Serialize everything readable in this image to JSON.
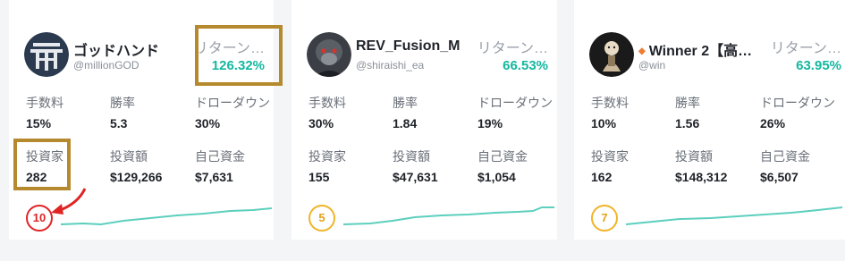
{
  "labels": {
    "fee": "手数料",
    "win_rate": "勝率",
    "drawdown": "ドローダウン",
    "investors": "投資家",
    "investment": "投資額",
    "own_funds": "自己資金"
  },
  "cards": [
    {
      "name": "ゴッドハンド",
      "handle": "@millionGOD",
      "return_label": "リターン…",
      "return_value": "126.32%",
      "fee": "15%",
      "win_rate": "5.3",
      "drawdown": "30%",
      "investors": "282",
      "investment": "$129,266",
      "own_funds": "$7,631",
      "rank": "10"
    },
    {
      "name": "REV_Fusion_M",
      "handle": "@shiraishi_ea",
      "return_label": "リターン…",
      "return_value": "66.53%",
      "fee": "30%",
      "win_rate": "1.84",
      "drawdown": "19%",
      "investors": "155",
      "investment": "$47,631",
      "own_funds": "$1,054",
      "rank": "5"
    },
    {
      "name": "Winner 2【高…",
      "handle": "@win",
      "return_label": "リターン…",
      "return_value": "63.95%",
      "fee": "10%",
      "win_rate": "1.56",
      "drawdown": "26%",
      "investors": "162",
      "investment": "$148,312",
      "own_funds": "$6,507",
      "rank": "7"
    }
  ],
  "colors": {
    "return": "#14b8a0",
    "sparkline": "#5ccfbd",
    "rank_highlight": "#e02424",
    "rank_default": "#f0b429",
    "annotation_box": "#b58a2f",
    "annotation_arrow": "#e02424"
  },
  "icons": [
    "crest-logo-icon",
    "gorilla-avatar-icon",
    "character-avatar-icon",
    "diamond-icon",
    "annotation-arrow-icon"
  ]
}
